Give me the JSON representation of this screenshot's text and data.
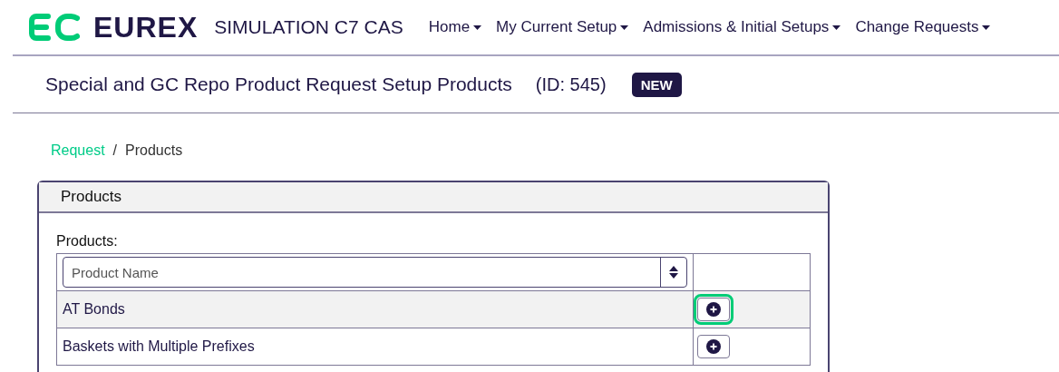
{
  "header": {
    "brand": "EUREX",
    "environment": "SIMULATION C7 CAS",
    "nav": [
      {
        "label": "Home"
      },
      {
        "label": "My Current Setup"
      },
      {
        "label": "Admissions & Initial Setups"
      },
      {
        "label": "Change Requests"
      }
    ]
  },
  "page": {
    "title": "Special and GC Repo Product Request Setup Products",
    "id": "(ID: 545)",
    "badge": "NEW"
  },
  "breadcrumb": [
    {
      "label": "Request",
      "kind": "link"
    },
    {
      "label": "/",
      "kind": "separator"
    },
    {
      "label": "Products",
      "kind": "current"
    }
  ],
  "card": {
    "title": "Products",
    "field_label": "Products:",
    "filter": {
      "placeholder": "Product Name"
    },
    "rows": [
      {
        "name": "AT Bonds",
        "selected": true,
        "focused": true
      },
      {
        "name": "Baskets with Multiple Prefixes",
        "selected": false,
        "focused": false
      }
    ]
  }
}
